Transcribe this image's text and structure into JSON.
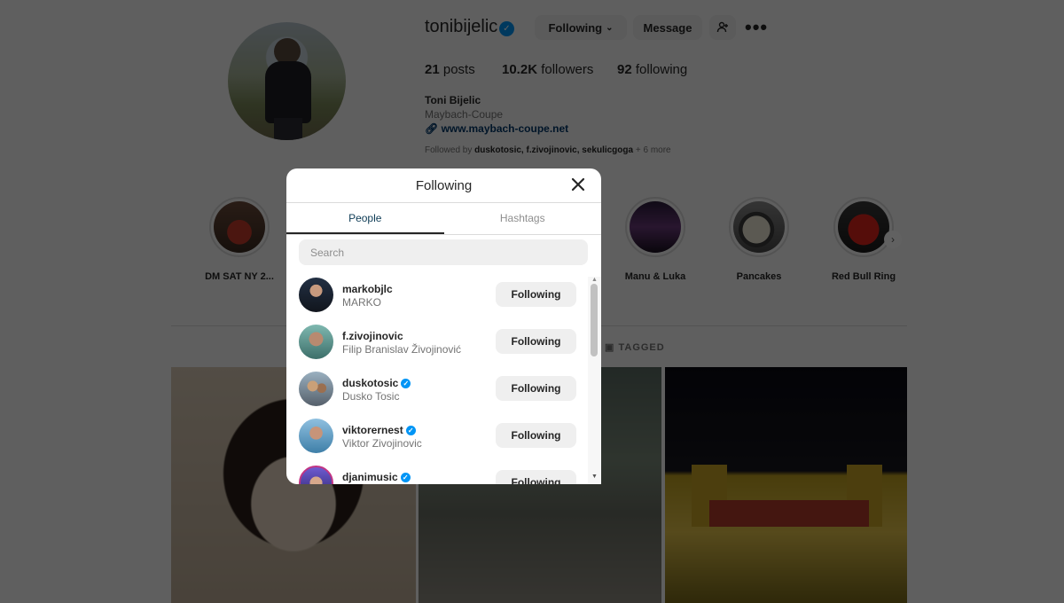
{
  "profile": {
    "username": "tonibijelic",
    "following_button": "Following",
    "message_button": "Message",
    "posts_count": "21",
    "posts_label": "posts",
    "followers_count": "10.2K",
    "followers_label": "followers",
    "following_count": "92",
    "following_label": "following",
    "full_name": "Toni Bijelic",
    "category": "Maybach-Coupe",
    "website": "www.maybach-coupe.net",
    "followed_by_prefix": "Followed by",
    "followed_by_names": "duskotosic, f.zivojinovic, sekulicgoga",
    "followed_by_more": "+ 6 more"
  },
  "highlights": [
    {
      "label": "DM SAT NY 2..."
    },
    {
      "label": "Manu & Luka"
    },
    {
      "label": "Pancakes"
    },
    {
      "label": "Red Bull Ring"
    }
  ],
  "profile_tabs": {
    "tagged": "TAGGED"
  },
  "modal": {
    "title": "Following",
    "tabs": [
      "People",
      "Hashtags"
    ],
    "active_tab": "People",
    "search_placeholder": "Search",
    "search_value": "",
    "accounts": [
      {
        "username": "markobjlc",
        "full_name": "MARKO",
        "verified": false,
        "button": "Following"
      },
      {
        "username": "f.zivojinovic",
        "full_name": "Filip Branislav Živojinović",
        "verified": false,
        "button": "Following"
      },
      {
        "username": "duskotosic",
        "full_name": "Dusko Tosic",
        "verified": true,
        "button": "Following"
      },
      {
        "username": "viktorernest",
        "full_name": "Viktor Zivojinovic",
        "verified": true,
        "button": "Following"
      },
      {
        "username": "djanimusic",
        "full_name": "",
        "verified": true,
        "button": "Following"
      }
    ]
  },
  "icons": {
    "verified": "verified-badge-icon",
    "close": "close-icon",
    "link": "link-icon",
    "chevron": "chevron-down-icon",
    "add_user": "add-user-icon",
    "more": "more-options-icon",
    "tagged": "tagged-icon"
  },
  "colors": {
    "verified_blue": "#0095f6",
    "active_tab_text": "#0d3b55",
    "button_bg": "#efefef",
    "overlay": "rgba(0,0,0,0.62)"
  }
}
